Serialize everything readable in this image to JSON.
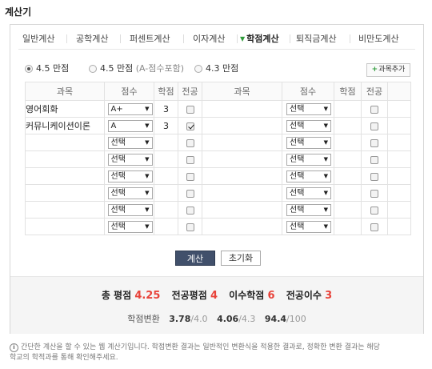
{
  "title": "계산기",
  "tabs": [
    {
      "label": "일반계산"
    },
    {
      "label": "공학계산"
    },
    {
      "label": "퍼센트계산"
    },
    {
      "label": "이자계산"
    },
    {
      "label": "학점계산",
      "active": true
    },
    {
      "label": "퇴직금계산"
    },
    {
      "label": "비만도계산"
    }
  ],
  "scale_options": [
    {
      "label": "4.5 만점",
      "sub": "",
      "selected": true
    },
    {
      "label": "4.5 만점",
      "sub": "(A-점수포함)",
      "selected": false
    },
    {
      "label": "4.3 만점",
      "sub": "",
      "selected": false
    }
  ],
  "add_course_label": "과목추가",
  "table": {
    "headers": [
      "과목",
      "점수",
      "학점",
      "전공",
      "과목",
      "점수",
      "학점",
      "전공"
    ],
    "left": [
      {
        "subject": "영어회화",
        "grade": "A+",
        "credit": "3",
        "major": false
      },
      {
        "subject": "커뮤니케이션이론",
        "grade": "A",
        "credit": "3",
        "major": true
      },
      {
        "subject": "",
        "grade": "선택",
        "credit": "",
        "major": false
      },
      {
        "subject": "",
        "grade": "선택",
        "credit": "",
        "major": false
      },
      {
        "subject": "",
        "grade": "선택",
        "credit": "",
        "major": false
      },
      {
        "subject": "",
        "grade": "선택",
        "credit": "",
        "major": false
      },
      {
        "subject": "",
        "grade": "선택",
        "credit": "",
        "major": false
      },
      {
        "subject": "",
        "grade": "선택",
        "credit": "",
        "major": false
      }
    ],
    "right": [
      {
        "subject": "",
        "grade": "선택",
        "credit": "",
        "major": false
      },
      {
        "subject": "",
        "grade": "선택",
        "credit": "",
        "major": false
      },
      {
        "subject": "",
        "grade": "선택",
        "credit": "",
        "major": false
      },
      {
        "subject": "",
        "grade": "선택",
        "credit": "",
        "major": false
      },
      {
        "subject": "",
        "grade": "선택",
        "credit": "",
        "major": false
      },
      {
        "subject": "",
        "grade": "선택",
        "credit": "",
        "major": false
      },
      {
        "subject": "",
        "grade": "선택",
        "credit": "",
        "major": false
      },
      {
        "subject": "",
        "grade": "선택",
        "credit": "",
        "major": false
      }
    ]
  },
  "buttons": {
    "calc": "계산",
    "reset": "초기화"
  },
  "result": {
    "total_gpa_label": "총 평점",
    "total_gpa": "4.25",
    "major_gpa_label": "전공평점",
    "major_gpa": "4",
    "credits_label": "이수학점",
    "credits": "6",
    "major_credits_label": "전공이수",
    "major_credits": "3"
  },
  "conversion": {
    "label": "학점변환",
    "items": [
      {
        "value": "3.78",
        "denom": "/4.0"
      },
      {
        "value": "4.06",
        "denom": "/4.3"
      },
      {
        "value": "94.4",
        "denom": "/100"
      }
    ]
  },
  "note": {
    "icon": "info-icon",
    "line1": "간단한 계산을 할 수 있는 웹 계산기입니다. 학점변환 결과는 일반적인 변환식을 적용한 결과로, 정확한 변환 결과는 해당",
    "line2": "학교의 학적과를 통해 확인해주세요."
  },
  "colors": {
    "accent": "#e8433a",
    "calc_button": "#41506b",
    "tab_marker": "#2e9b3a"
  }
}
